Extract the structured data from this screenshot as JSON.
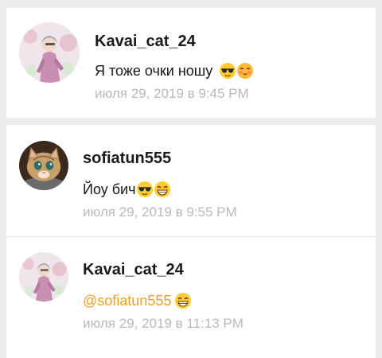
{
  "comments": [
    {
      "username": "Kavai_cat_24",
      "text": "Я тоже очки ношу",
      "emojis": [
        "sunglasses-face-icon",
        "blushing-face-icon"
      ],
      "timestamp": "июля 29, 2019 в 9:45 PM"
    },
    {
      "username": "sofiatun555",
      "text": "Йоу бич",
      "emojis": [
        "sunglasses-face-icon",
        "grinning-face-icon"
      ],
      "timestamp": "июля 29, 2019 в 9:55 PM"
    },
    {
      "username": "Kavai_cat_24",
      "mention": "@sofiatun555",
      "emojis": [
        "grinning-face-icon"
      ],
      "timestamp": "июля 29, 2019 в 11:13 PM"
    }
  ]
}
